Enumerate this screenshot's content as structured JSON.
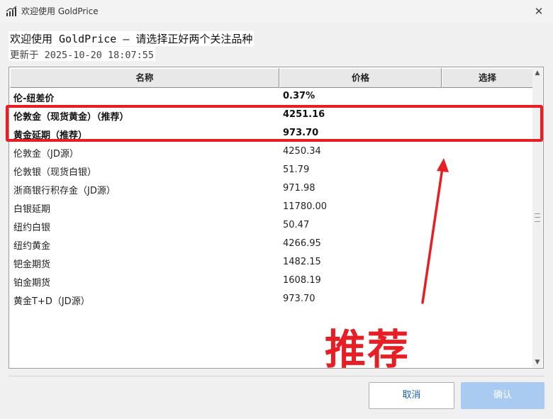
{
  "window": {
    "title": "欢迎使用 GoldPrice",
    "close_glyph": "✕"
  },
  "header": {
    "heading": "欢迎使用 GoldPrice — 请选择正好两个关注品种",
    "updated": "更新于 2025-10-20 18:07:55"
  },
  "table": {
    "columns": [
      "名称",
      "价格",
      "选择"
    ],
    "rows": [
      {
        "name": "伦-纽差价",
        "price": "0.37%",
        "bold": true
      },
      {
        "name": "伦敦金（现货黄金）（推荐）",
        "price": "4251.16",
        "bold": true
      },
      {
        "name": "黄金延期（推荐）",
        "price": "973.70",
        "bold": true
      },
      {
        "name": "伦敦金（JD源）",
        "price": "4250.34",
        "bold": false
      },
      {
        "name": "伦敦银（现货白银）",
        "price": "51.79",
        "bold": false
      },
      {
        "name": "浙商银行积存金（JD源）",
        "price": "971.98",
        "bold": false
      },
      {
        "name": "白银延期",
        "price": "11780.00",
        "bold": false
      },
      {
        "name": "纽约白银",
        "price": "50.47",
        "bold": false
      },
      {
        "name": "纽约黄金",
        "price": "4266.95",
        "bold": false
      },
      {
        "name": "钯金期货",
        "price": "1482.15",
        "bold": false
      },
      {
        "name": "铂金期货",
        "price": "1608.19",
        "bold": false
      },
      {
        "name": "黄金T+D（JD源）",
        "price": "973.70",
        "bold": false
      }
    ]
  },
  "scrollbar": {
    "up_glyph": "▲",
    "down_glyph": "▼"
  },
  "annotation": {
    "text": "推荐",
    "color": "#e81e25"
  },
  "buttons": {
    "cancel": "取消",
    "ok": "确认"
  },
  "colors": {
    "accent": "#1a5fb4",
    "ok_disabled": "#a9cbf2",
    "annotation_red": "#e81e25"
  }
}
